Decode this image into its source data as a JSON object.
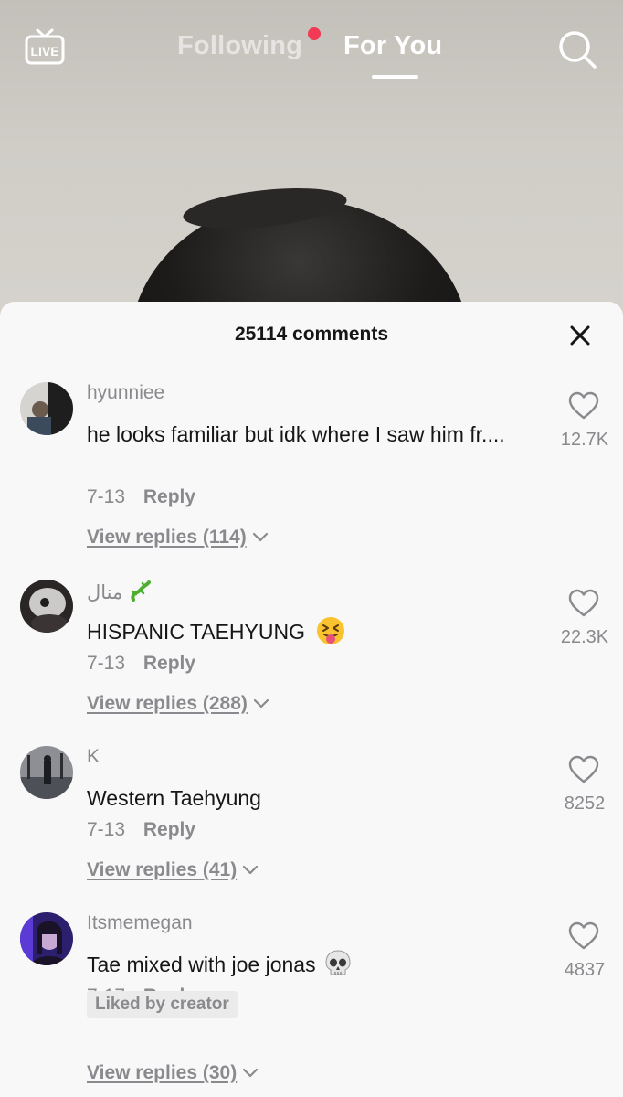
{
  "top_bar": {
    "live_label": "LIVE",
    "tab_following": "Following",
    "tab_for_you": "For You",
    "notification_dot_color": "#f23a54"
  },
  "comments_sheet": {
    "title": "25114 comments",
    "comments": [
      {
        "username": "hyunniee",
        "text": "he looks familiar but idk where I saw him fr....",
        "date": "7-13",
        "reply_label": "Reply",
        "view_replies": "View replies (114)",
        "like_count": "12.7K",
        "liked_by_creator": false
      },
      {
        "username": "منال",
        "username_emoji": "lizard",
        "text": "HISPANIC TAEHYUNG",
        "text_emoji": "squinting-face-with-tongue",
        "date": "7-13",
        "reply_label": "Reply",
        "view_replies": "View replies (288)",
        "like_count": "22.3K",
        "liked_by_creator": false
      },
      {
        "username": "K",
        "text": "Western Taehyung",
        "date": "7-13",
        "reply_label": "Reply",
        "view_replies": "View replies (41)",
        "like_count": "8252",
        "liked_by_creator": false
      },
      {
        "username": "Itsmemegan",
        "text": "Tae mixed with joe jonas",
        "text_emoji": "skull",
        "date": "7-17",
        "reply_label": "Reply",
        "view_replies": "View replies (30)",
        "like_count": "4837",
        "liked_by_creator": true,
        "liked_by_label": "Liked by creator"
      }
    ]
  },
  "colors": {
    "sheet_background": "#f8f8f8",
    "primary_text": "#161616",
    "secondary_text": "#8a8a8e"
  }
}
